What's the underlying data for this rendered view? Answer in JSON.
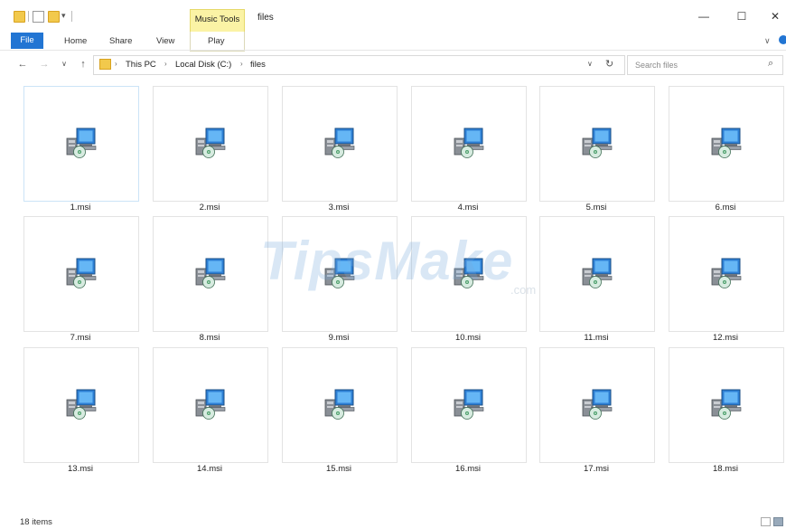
{
  "window": {
    "title": "files",
    "contextual_tab_group": "Music Tools",
    "controls": {
      "minimize": "—",
      "maximize": "☐",
      "close": "✕"
    }
  },
  "ribbon": {
    "tabs": [
      "File",
      "Home",
      "Share",
      "View",
      "Play"
    ],
    "toggle": "∨"
  },
  "address_bar": {
    "nav": {
      "back": "←",
      "forward": "→",
      "recent": "∨",
      "up": "↑"
    },
    "breadcrumb": [
      "This PC",
      "Local Disk (C:)",
      "files"
    ],
    "separator": "›",
    "dropdown": "∨",
    "refresh": "↻"
  },
  "search": {
    "placeholder": "Search files",
    "icon": "search-icon"
  },
  "files": [
    "1.msi",
    "2.msi",
    "3.msi",
    "4.msi",
    "5.msi",
    "6.msi",
    "7.msi",
    "8.msi",
    "9.msi",
    "10.msi",
    "11.msi",
    "12.msi",
    "13.msi",
    "14.msi",
    "15.msi",
    "16.msi",
    "17.msi",
    "18.msi"
  ],
  "watermark": {
    "text": "TipsMake",
    "suffix": ".com"
  },
  "status": {
    "item_count": "18 items"
  },
  "colors": {
    "accent": "#2275d3",
    "music_tools": "#fbf3a5"
  }
}
